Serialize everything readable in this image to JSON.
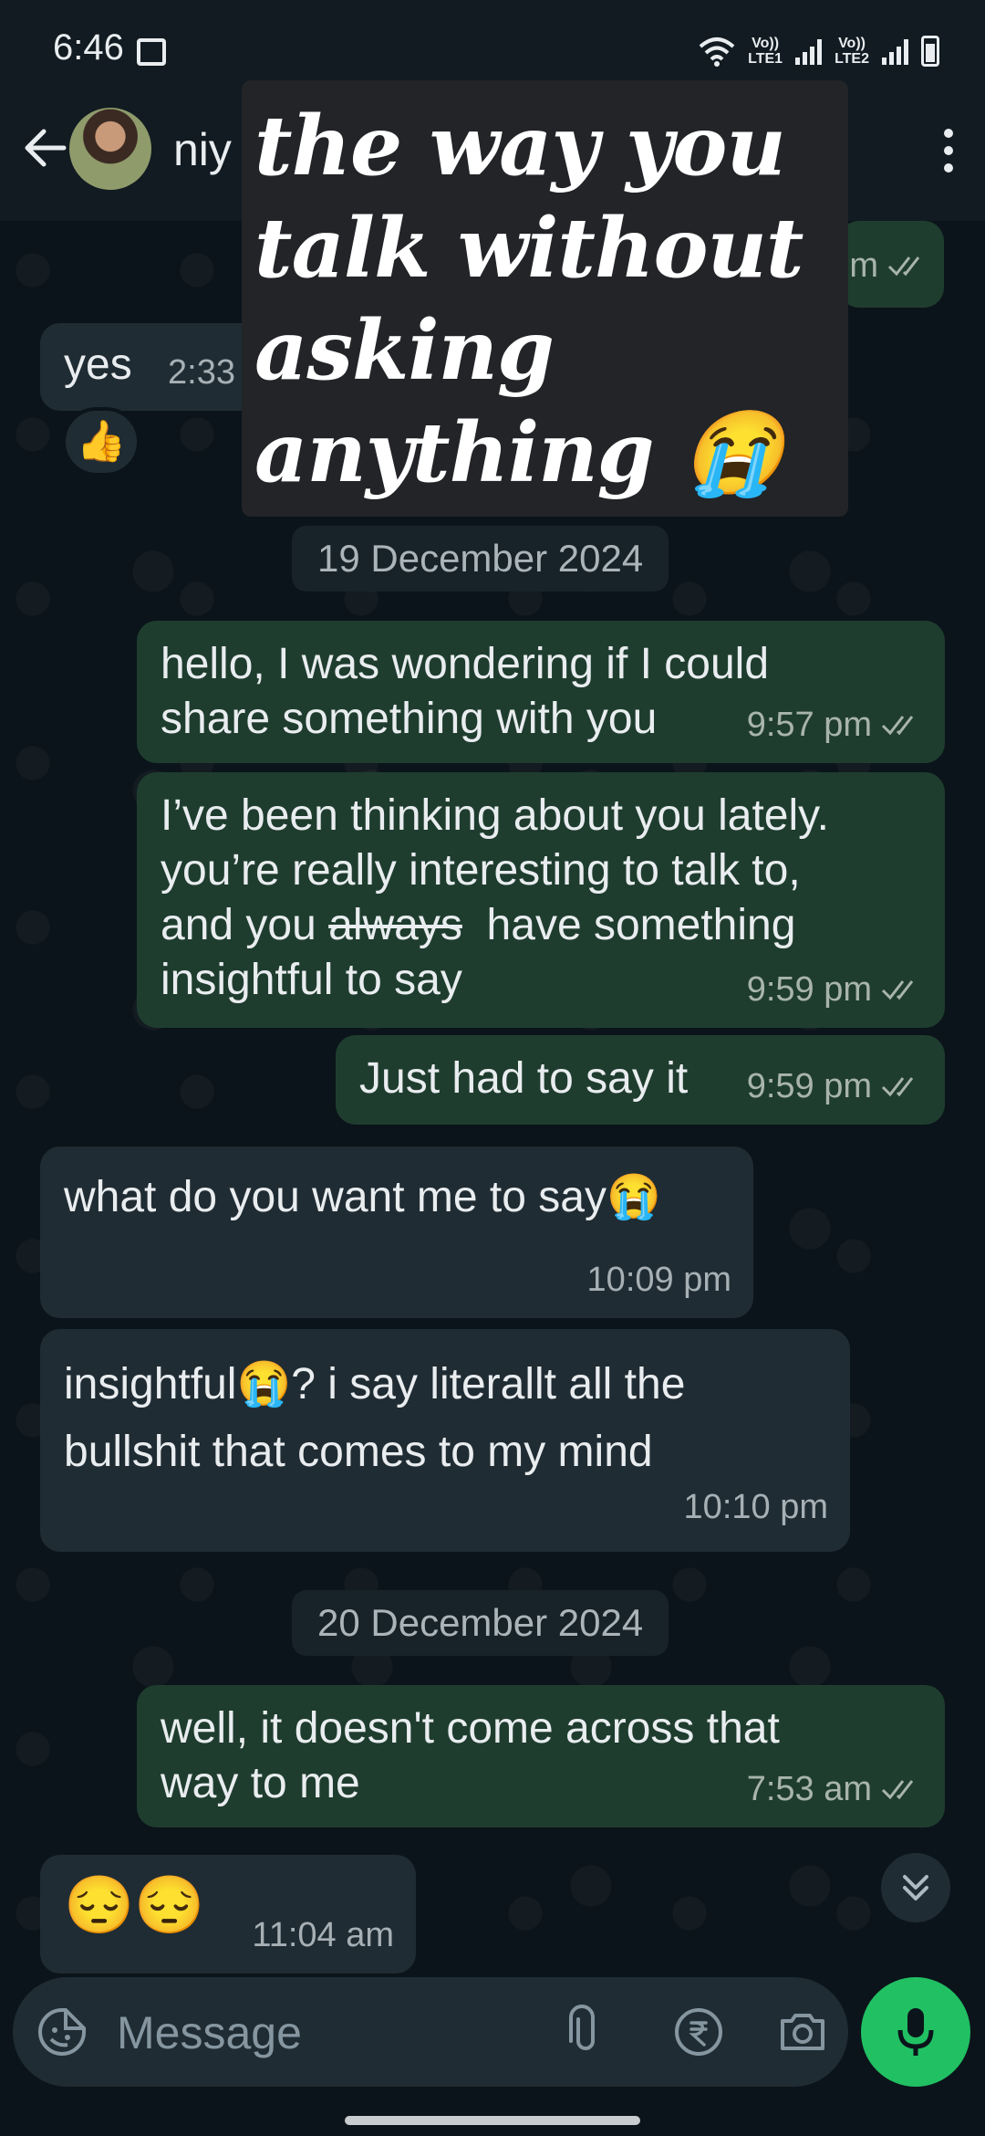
{
  "status_bar": {
    "time": "6:46",
    "sim1": [
      "Vo))",
      "LTE1"
    ],
    "sim2": [
      "Vo))",
      "LTE2"
    ]
  },
  "header": {
    "contact_name": "niy"
  },
  "overlay_text": {
    "lines": [
      "the way you",
      "talk without",
      "asking",
      "anything 😭"
    ]
  },
  "messages": {
    "m0_time": "m",
    "m1": {
      "text": "yes",
      "time": "2:33",
      "reaction": "👍"
    },
    "date1": "19 December 2024",
    "m2": {
      "text_line1": "hello, I was wondering if I could",
      "text_line2": "share something with you",
      "time": "9:57 pm"
    },
    "m3": {
      "line1": "I’ve been thinking about you lately.",
      "line2": "you’re really interesting to talk to,",
      "line3_pre": "and you ",
      "line3_strike": "always",
      "line3_post": "  have something",
      "line4": "insightful to say",
      "time": "9:59 pm"
    },
    "m4": {
      "text": "Just had to say it",
      "time": "9:59 pm"
    },
    "m5": {
      "text": "what do you want me to say😭",
      "time": "10:09 pm"
    },
    "m6": {
      "line1": "insightful😭? i say literallt all the",
      "line2": "bullshit that comes to my mind",
      "time": "10:10 pm"
    },
    "date2": "20 December 2024",
    "m7": {
      "line1": "well, it doesn't come across that",
      "line2": "way to me",
      "time": "7:53 am"
    },
    "m8": {
      "text": "😔😔",
      "time": "11:04 am"
    }
  },
  "composer": {
    "placeholder": "Message"
  },
  "colors": {
    "outgoing_bubble": "#1f3d2f",
    "incoming_bubble": "#202c33",
    "accent_green": "#21c063",
    "background": "#0b141a"
  },
  "icons": [
    "back-arrow-icon",
    "menu-dots-icon",
    "sticker-icon",
    "attach-icon",
    "rupee-icon",
    "camera-icon",
    "mic-icon",
    "double-chevron-down-icon",
    "double-check-icon"
  ]
}
